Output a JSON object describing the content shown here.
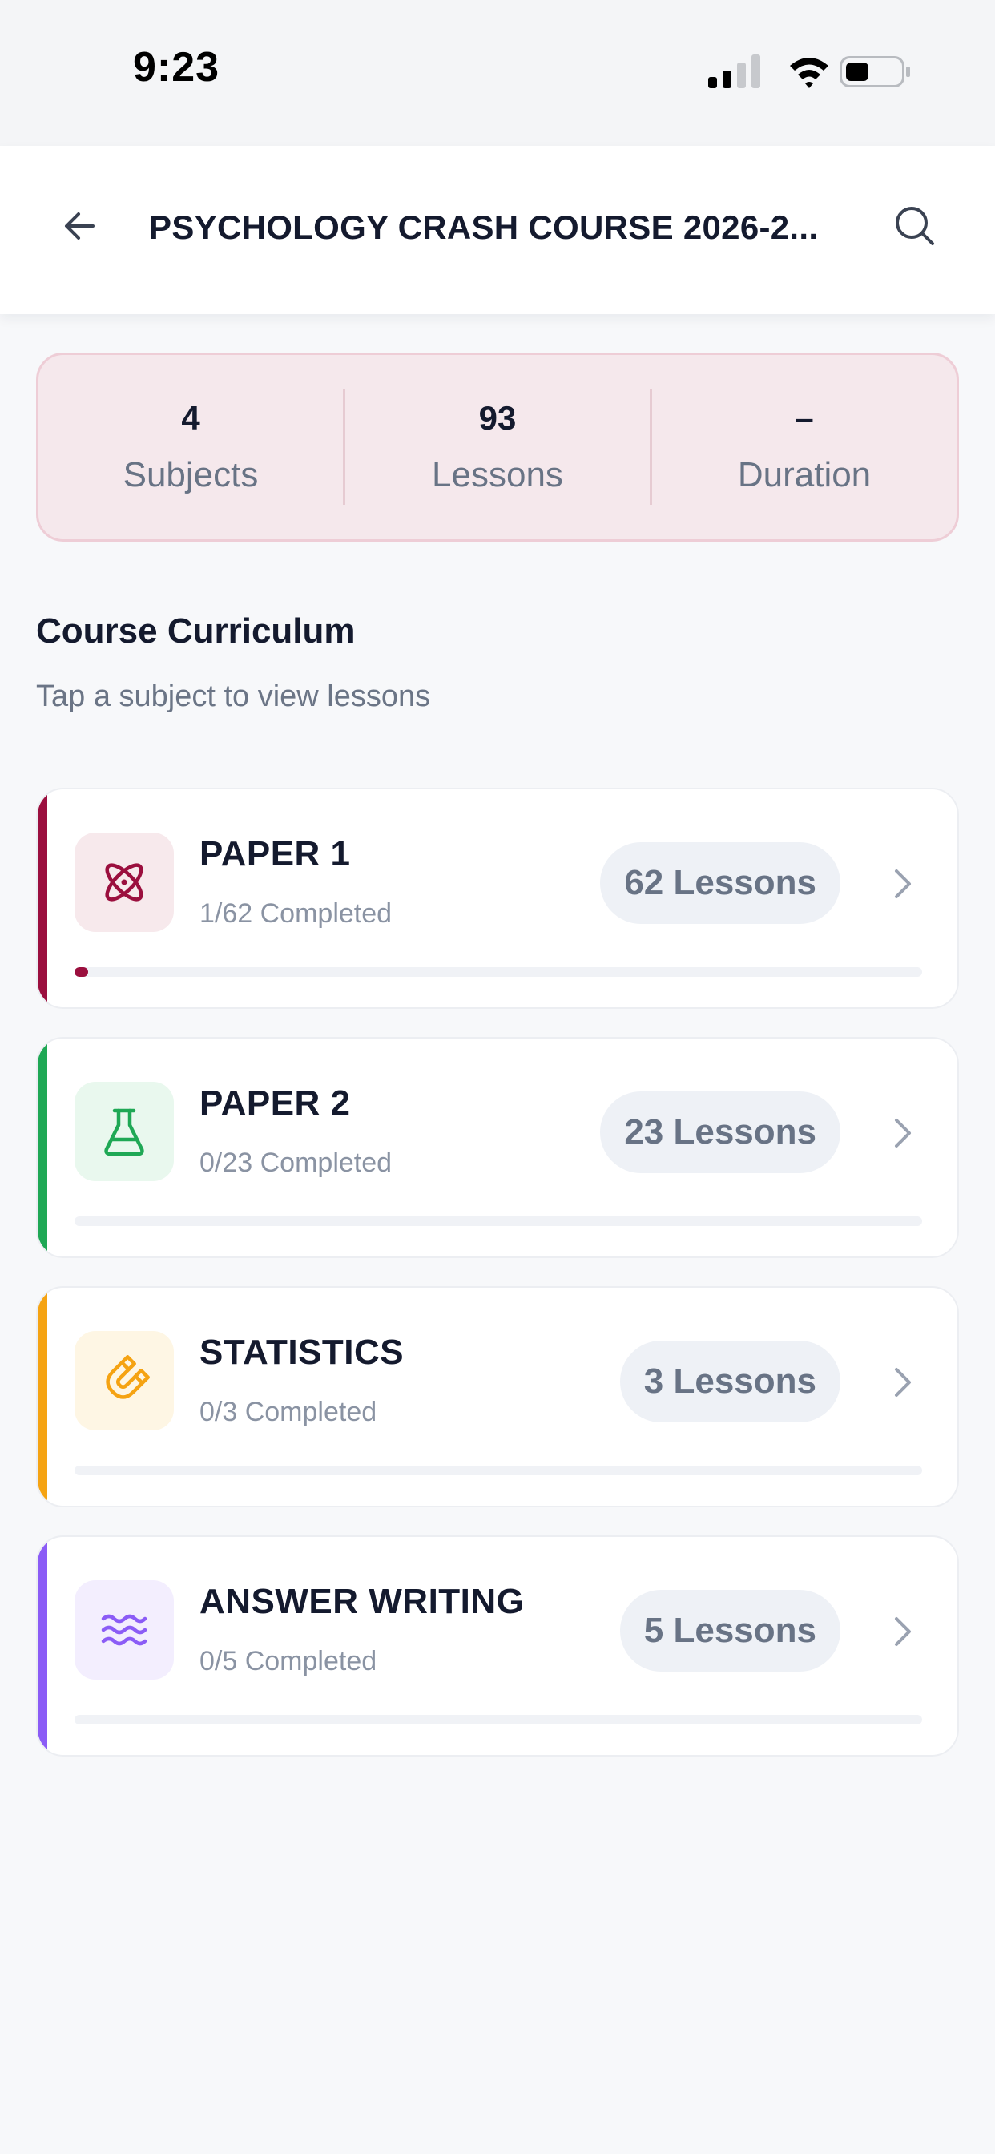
{
  "status_bar": {
    "time": "9:23"
  },
  "header": {
    "title": "PSYCHOLOGY CRASH COURSE 2026-2...",
    "back_icon": "arrow-left-icon",
    "search_icon": "search-icon"
  },
  "stats": [
    {
      "value": "4",
      "label": "Subjects"
    },
    {
      "value": "93",
      "label": "Lessons"
    },
    {
      "value": "–",
      "label": "Duration"
    }
  ],
  "curriculum": {
    "title": "Course Curriculum",
    "subtitle": "Tap a subject to view lessons"
  },
  "subjects": [
    {
      "name": "PAPER 1",
      "progress_text": "1/62 Completed",
      "lessons_label": "62 Lessons",
      "progress_fraction": 0.016,
      "icon": "atom-icon",
      "accent_color": "#9b0f3e",
      "icon_bg": "#f7e9ec"
    },
    {
      "name": "PAPER 2",
      "progress_text": "0/23 Completed",
      "lessons_label": "23 Lessons",
      "progress_fraction": 0,
      "icon": "flask-icon",
      "accent_color": "#1fa855",
      "icon_bg": "#e9f8ee"
    },
    {
      "name": "STATISTICS",
      "progress_text": "0/3 Completed",
      "lessons_label": "3 Lessons",
      "progress_fraction": 0,
      "icon": "magnet-icon",
      "accent_color": "#f5a313",
      "icon_bg": "#fef6e4"
    },
    {
      "name": "ANSWER WRITING",
      "progress_text": "0/5 Completed",
      "lessons_label": "5 Lessons",
      "progress_fraction": 0,
      "icon": "waves-icon",
      "accent_color": "#8b5cf6",
      "icon_bg": "#f3eefe"
    }
  ]
}
